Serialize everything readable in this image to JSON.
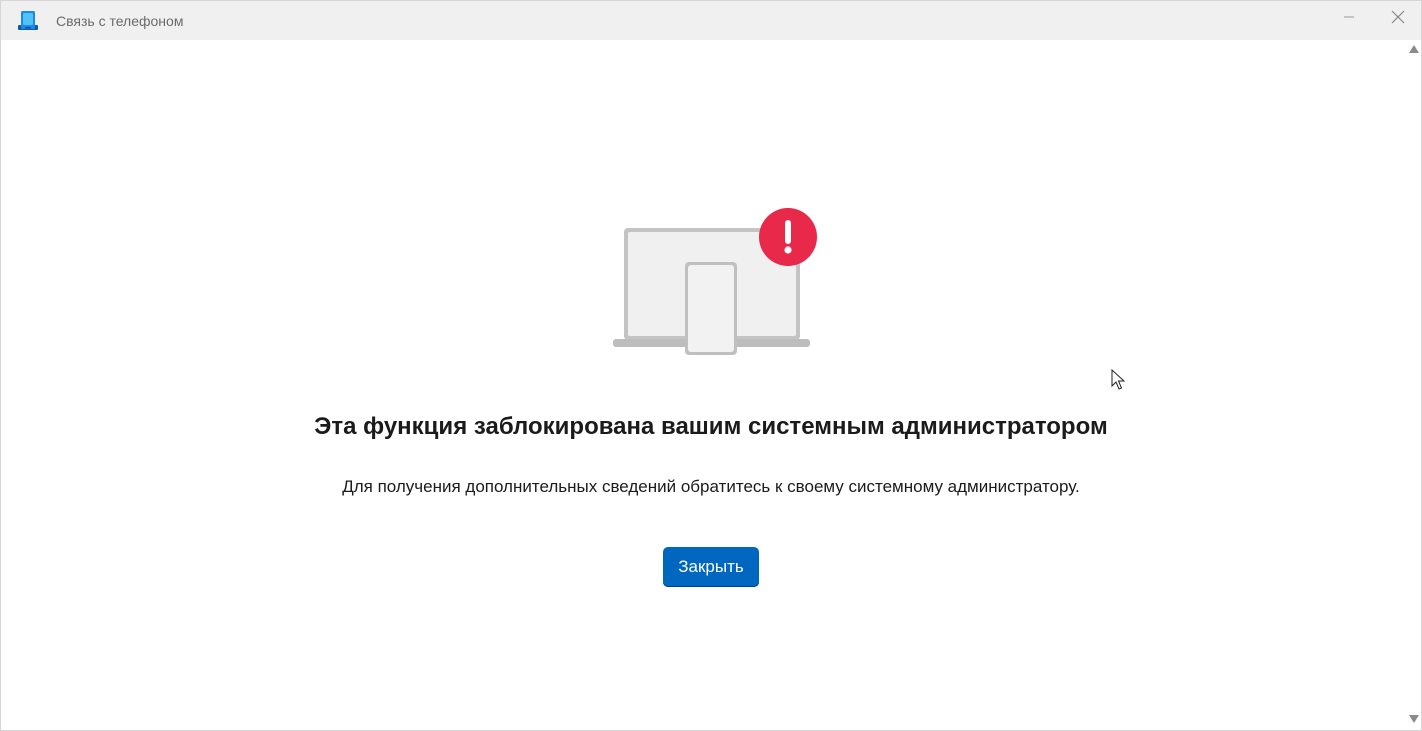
{
  "window": {
    "title": "Связь с телефоном",
    "minimize_icon": "minimize-icon",
    "close_icon": "close-icon",
    "app_icon": "phone-link-app-icon"
  },
  "illustration": {
    "icon": "laptop-phone-blocked-illustration",
    "badge_icon": "exclamation-icon",
    "badge_color": "#e8294a",
    "badge_glyph": "!"
  },
  "main": {
    "heading": "Эта функция заблокирована вашим системным администратором",
    "description": "Для получения дополнительных сведений обратитесь к своему системному администратору.",
    "close_label": "Закрыть"
  },
  "colors": {
    "accent": "#0067c0",
    "titlebar": "#f0f0f0",
    "text": "#1b1b1b"
  }
}
